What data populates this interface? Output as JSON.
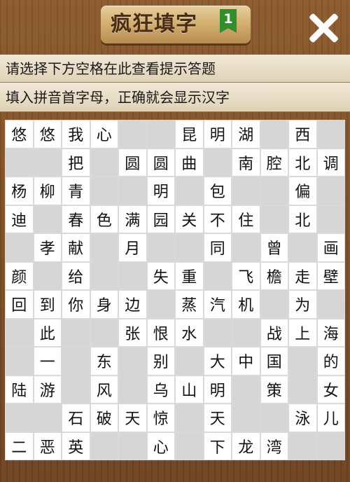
{
  "header": {
    "title": "疯狂填字",
    "level": "1",
    "close_icon": "close-icon"
  },
  "hints": {
    "line1": "请选择下方空格在此查看提示答题",
    "line2": "填入拼音首字母，正确就会显示汉字"
  },
  "board": {
    "rows": [
      [
        "悠",
        "悠",
        "我",
        "心",
        "",
        "",
        "昆",
        "明",
        "湖",
        "",
        "西",
        ""
      ],
      [
        "",
        "",
        "把",
        "",
        "圆",
        "圆",
        "曲",
        "",
        "南",
        "腔",
        "北",
        "调"
      ],
      [
        "杨",
        "柳",
        "青",
        "",
        "",
        "明",
        "",
        "包",
        "",
        "",
        "偏",
        ""
      ],
      [
        "迪",
        "",
        "春",
        "色",
        "满",
        "园",
        "关",
        "不",
        "住",
        "",
        "北",
        ""
      ],
      [
        "",
        "孝",
        "献",
        "",
        "月",
        "",
        "",
        "同",
        "",
        "曾",
        "",
        "画"
      ],
      [
        "颜",
        "",
        "给",
        "",
        "",
        "失",
        "重",
        "",
        "飞",
        "檐",
        "走",
        "壁"
      ],
      [
        "回",
        "到",
        "你",
        "身",
        "边",
        "",
        "蒸",
        "汽",
        "机",
        "",
        "为",
        ""
      ],
      [
        "",
        "此",
        "",
        "",
        "张",
        "恨",
        "水",
        "",
        "",
        "战",
        "上",
        "海"
      ],
      [
        "",
        "一",
        "",
        "东",
        "",
        "别",
        "",
        "大",
        "中",
        "国",
        "",
        "的"
      ],
      [
        "陆",
        "游",
        "",
        "风",
        "",
        "乌",
        "山",
        "明",
        "",
        "策",
        "",
        "女"
      ],
      [
        "",
        "",
        "石",
        "破",
        "天",
        "惊",
        "",
        "天",
        "",
        "",
        "泳",
        "儿"
      ],
      [
        "二",
        "恶",
        "英",
        "",
        "",
        "心",
        "",
        "下",
        "龙",
        "湾",
        "",
        ""
      ]
    ]
  }
}
